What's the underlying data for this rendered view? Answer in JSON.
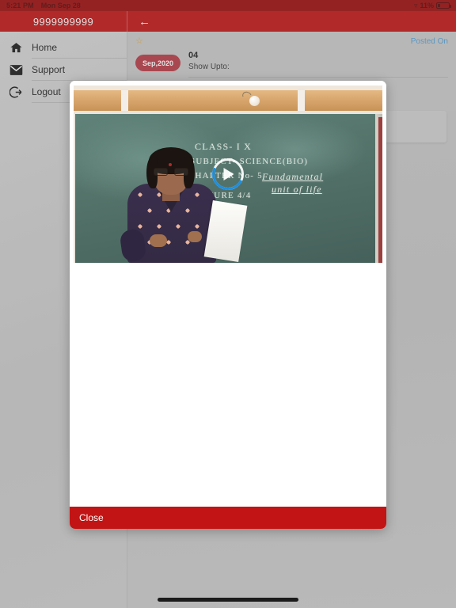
{
  "statusbar": {
    "time": "5:21 PM",
    "date": "Mon Sep 28",
    "wifi_icon": "wifi-icon",
    "battery_percent": "11%"
  },
  "topbar": {
    "account_number": "9999999999",
    "back_icon": "back-arrow-icon"
  },
  "sidebar": {
    "items": [
      {
        "label": "Home",
        "icon": "home-icon"
      },
      {
        "label": "Support",
        "icon": "envelope-icon"
      },
      {
        "label": "Logout",
        "icon": "logout-icon"
      }
    ]
  },
  "post": {
    "star_icon": "star-icon",
    "posted_on_label": "Posted On",
    "month_badge": "Sep,2020",
    "day": "04",
    "show_upto_label": "Show Upto:"
  },
  "modal": {
    "video": {
      "play_icon": "play-button-icon",
      "blackboard": {
        "line1": "CLASS- I X",
        "line2": "SUBJECT- SCIENCE(BIO)",
        "line3": "CHAPTER No- 5",
        "line4": "Fundamental",
        "line5": "unit of life",
        "line6": "LECTURE  4/4"
      }
    },
    "close_label": "Close"
  },
  "colors": {
    "brand_red": "#c21414",
    "statusbar_red": "#9e0b0b",
    "badge_red": "#b83a46",
    "link_blue": "#57a0d6",
    "star_gold": "#e0a83c",
    "play_arc_blue": "#1d8fe0",
    "page_gray": "#c9c9c9"
  }
}
